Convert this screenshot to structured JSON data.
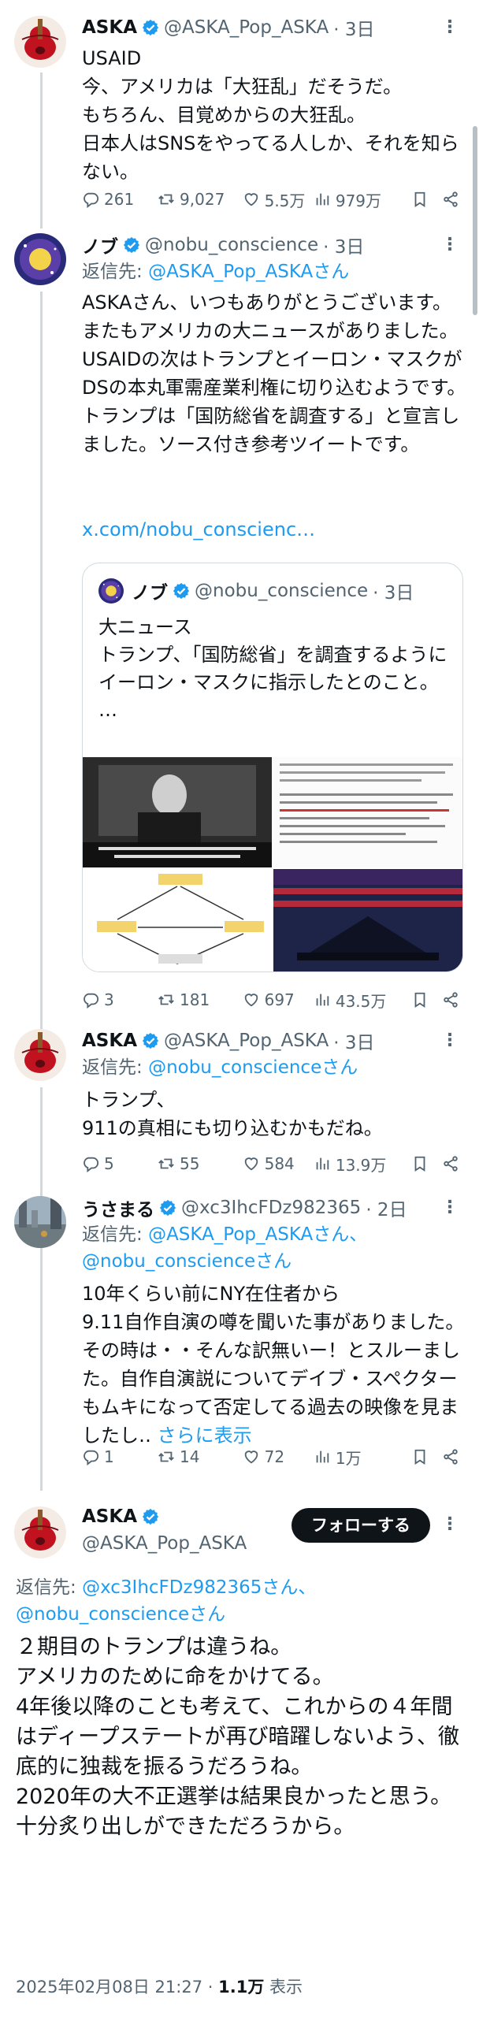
{
  "colors": {
    "link": "#1d9bf0",
    "muted": "#536471",
    "verified": "#1d9bf0",
    "text": "#0f1419"
  },
  "tweets": [
    {
      "name": "ASKA",
      "handle": "@ASKA_Pop_ASKA",
      "time": "· 3日",
      "body": "USAID\n今、アメリカは「大狂乱」だそうだ。\nもちろん、目覚めからの大狂乱。\n日本人はSNSをやってる人しか、それを知らない。",
      "replies": "261",
      "retweets": "9,027",
      "likes": "5.5万",
      "views": "979万"
    },
    {
      "name": "ノブ",
      "handle": "@nobu_conscience",
      "time": "· 3日",
      "reply_prefix": "返信先:",
      "reply_to": "@ASKA_Pop_ASKAさん",
      "body": "ASKAさん、いつもありがとうございます。またもアメリカの大ニュースがありました。\nUSAIDの次はトランプとイーロン・マスクが\nDSの本丸軍需産業利権に切り込むようです。\nトランプは「国防総省を調査する」と宣言しました。ソース付き参考ツイートです。",
      "link": "x.com/nobu_conscienc…",
      "quote": {
        "name": "ノブ",
        "handle": "@nobu_conscience",
        "time": "· 3日",
        "body": "大ニュース\nトランプ、「国防総省」を調査するようにイーロン・マスクに指示したとのこと。\n…"
      },
      "replies": "3",
      "retweets": "181",
      "likes": "697",
      "views": "43.5万"
    },
    {
      "name": "ASKA",
      "handle": "@ASKA_Pop_ASKA",
      "time": "· 3日",
      "reply_prefix": "返信先:",
      "reply_to": "@nobu_conscienceさん",
      "body": "トランプ、\n911の真相にも切り込むかもだね。",
      "replies": "5",
      "retweets": "55",
      "likes": "584",
      "views": "13.9万"
    },
    {
      "name": "うさまる",
      "handle": "@xc3IhcFDz982365",
      "time": "· 2日",
      "reply_prefix": "返信先:",
      "reply_to": "@ASKA_Pop_ASKAさん、",
      "reply_to_2": "@nobu_conscienceさん",
      "body": "10年くらい前にNY在住者から\n9.11自作自演の噂を聞いた事がありました。その時は・・そんな訳無いー！とスルーました。自作自演説についてデイブ・スペクターもムキになって否定してる過去の映像を見ましたし‥",
      "show_more": "さらに表示",
      "replies": "1",
      "retweets": "14",
      "likes": "72",
      "views": "1万"
    }
  ],
  "main": {
    "name": "ASKA",
    "handle": "@ASKA_Pop_ASKA",
    "follow_label": "フォローする",
    "reply_prefix": "返信先:",
    "reply_to": "@xc3IhcFDz982365さん、",
    "reply_to_2": "@nobu_conscienceさん",
    "body": "２期目のトランプは違うね。\nアメリカのために命をかけてる。\n4年後以降のことも考えて、これからの４年間はディープステートが再び暗躍しないよう、徹底的に独裁を振るうだろうね。\n2020年の大不正選挙は結果良かったと思う。\n十分炙り出しができただろうから。",
    "timestamp": "2025年02月08日 21:27",
    "dot": "·",
    "views_count": "1.1万",
    "views_label": "表示"
  }
}
